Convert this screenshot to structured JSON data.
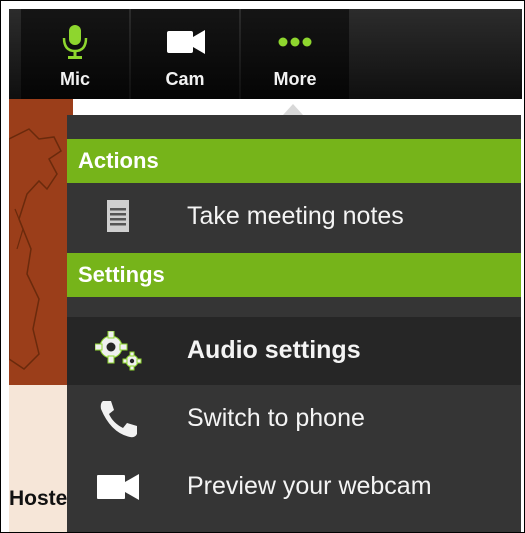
{
  "toolbar": {
    "mic": {
      "label": "Mic",
      "icon": "microphone-icon"
    },
    "cam": {
      "label": "Cam",
      "icon": "video-camera-icon"
    },
    "more": {
      "label": "More",
      "icon": "more-dots-icon"
    }
  },
  "background": {
    "partial_text": "Hoste"
  },
  "menu": {
    "sections": [
      {
        "title": "Actions",
        "items": [
          {
            "label": "Take meeting notes",
            "icon": "notepad-icon"
          }
        ]
      },
      {
        "title": "Settings",
        "items": [
          {
            "label": "Audio settings",
            "icon": "gears-icon",
            "active": true
          },
          {
            "label": "Switch to phone",
            "icon": "phone-icon"
          },
          {
            "label": "Preview your webcam",
            "icon": "webcam-icon"
          }
        ]
      }
    ]
  },
  "colors": {
    "accent_green": "#76b41a",
    "mic_active": "#8ed62e",
    "menu_bg": "#353535",
    "toolbar_bg": "#0b0b0b"
  }
}
